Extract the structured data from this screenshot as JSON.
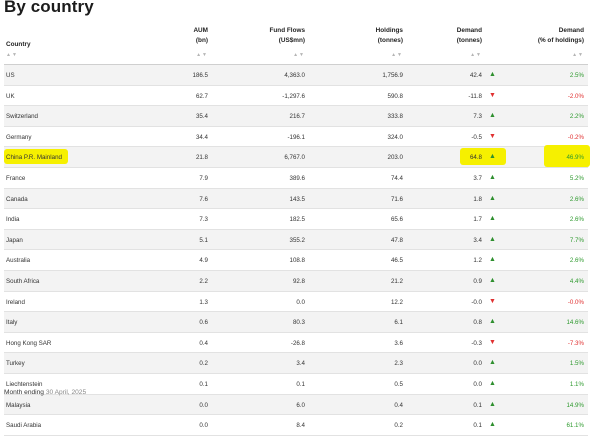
{
  "title": "By country",
  "columns": {
    "country": "Country",
    "aum": [
      "AUM",
      "(bn)"
    ],
    "flows": [
      "Fund Flows",
      "(US$mn)"
    ],
    "holdings": [
      "Holdings",
      "(tonnes)"
    ],
    "demand": [
      "Demand",
      "(tonnes)"
    ],
    "demand_pct": [
      "Demand",
      "(% of holdings)"
    ]
  },
  "sort_glyph": "▲▼",
  "colors": {
    "up": "#2e8f2e",
    "down": "#e03030",
    "highlight": "#f6f000",
    "alt_row": "#f3f3f3"
  },
  "rows": [
    {
      "country": "US",
      "aum": "186.5",
      "flows": "4,363.0",
      "holdings": "1,756.9",
      "demand": "42.4",
      "dir": "up",
      "pct": "2.5%"
    },
    {
      "country": "UK",
      "aum": "62.7",
      "flows": "-1,297.6",
      "holdings": "590.8",
      "demand": "-11.8",
      "dir": "down",
      "pct": "-2.0%"
    },
    {
      "country": "Switzerland",
      "aum": "35.4",
      "flows": "216.7",
      "holdings": "333.8",
      "demand": "7.3",
      "dir": "up",
      "pct": "2.2%"
    },
    {
      "country": "Germany",
      "aum": "34.4",
      "flows": "-196.1",
      "holdings": "324.0",
      "demand": "-0.5",
      "dir": "down",
      "pct": "-0.2%"
    },
    {
      "country": "China P.R. Mainland",
      "aum": "21.8",
      "flows": "6,767.0",
      "holdings": "203.0",
      "demand": "64.8",
      "dir": "up",
      "pct": "46.9%",
      "highlight": true
    },
    {
      "country": "France",
      "aum": "7.9",
      "flows": "389.6",
      "holdings": "74.4",
      "demand": "3.7",
      "dir": "up",
      "pct": "5.2%"
    },
    {
      "country": "Canada",
      "aum": "7.6",
      "flows": "143.5",
      "holdings": "71.6",
      "demand": "1.8",
      "dir": "up",
      "pct": "2.6%"
    },
    {
      "country": "India",
      "aum": "7.3",
      "flows": "182.5",
      "holdings": "65.6",
      "demand": "1.7",
      "dir": "up",
      "pct": "2.6%"
    },
    {
      "country": "Japan",
      "aum": "5.1",
      "flows": "355.2",
      "holdings": "47.8",
      "demand": "3.4",
      "dir": "up",
      "pct": "7.7%"
    },
    {
      "country": "Australia",
      "aum": "4.9",
      "flows": "108.8",
      "holdings": "46.5",
      "demand": "1.2",
      "dir": "up",
      "pct": "2.6%"
    },
    {
      "country": "South Africa",
      "aum": "2.2",
      "flows": "92.8",
      "holdings": "21.2",
      "demand": "0.9",
      "dir": "up",
      "pct": "4.4%"
    },
    {
      "country": "Ireland",
      "aum": "1.3",
      "flows": "0.0",
      "holdings": "12.2",
      "demand": "-0.0",
      "dir": "down",
      "pct": "-0.0%"
    },
    {
      "country": "Italy",
      "aum": "0.6",
      "flows": "80.3",
      "holdings": "6.1",
      "demand": "0.8",
      "dir": "up",
      "pct": "14.6%"
    },
    {
      "country": "Hong Kong SAR",
      "aum": "0.4",
      "flows": "-26.8",
      "holdings": "3.6",
      "demand": "-0.3",
      "dir": "down",
      "pct": "-7.3%"
    },
    {
      "country": "Turkey",
      "aum": "0.2",
      "flows": "3.4",
      "holdings": "2.3",
      "demand": "0.0",
      "dir": "up",
      "pct": "1.5%"
    },
    {
      "country": "Liechtenstein",
      "aum": "0.1",
      "flows": "0.1",
      "holdings": "0.5",
      "demand": "0.0",
      "dir": "up",
      "pct": "1.1%"
    },
    {
      "country": "Malaysia",
      "aum": "0.0",
      "flows": "6.0",
      "holdings": "0.4",
      "demand": "0.1",
      "dir": "up",
      "pct": "14.9%"
    },
    {
      "country": "Saudi Arabia",
      "aum": "0.0",
      "flows": "8.4",
      "holdings": "0.2",
      "demand": "0.1",
      "dir": "up",
      "pct": "61.1%"
    }
  ],
  "footer": {
    "label": "Month ending",
    "date": "30 April, 2025"
  }
}
